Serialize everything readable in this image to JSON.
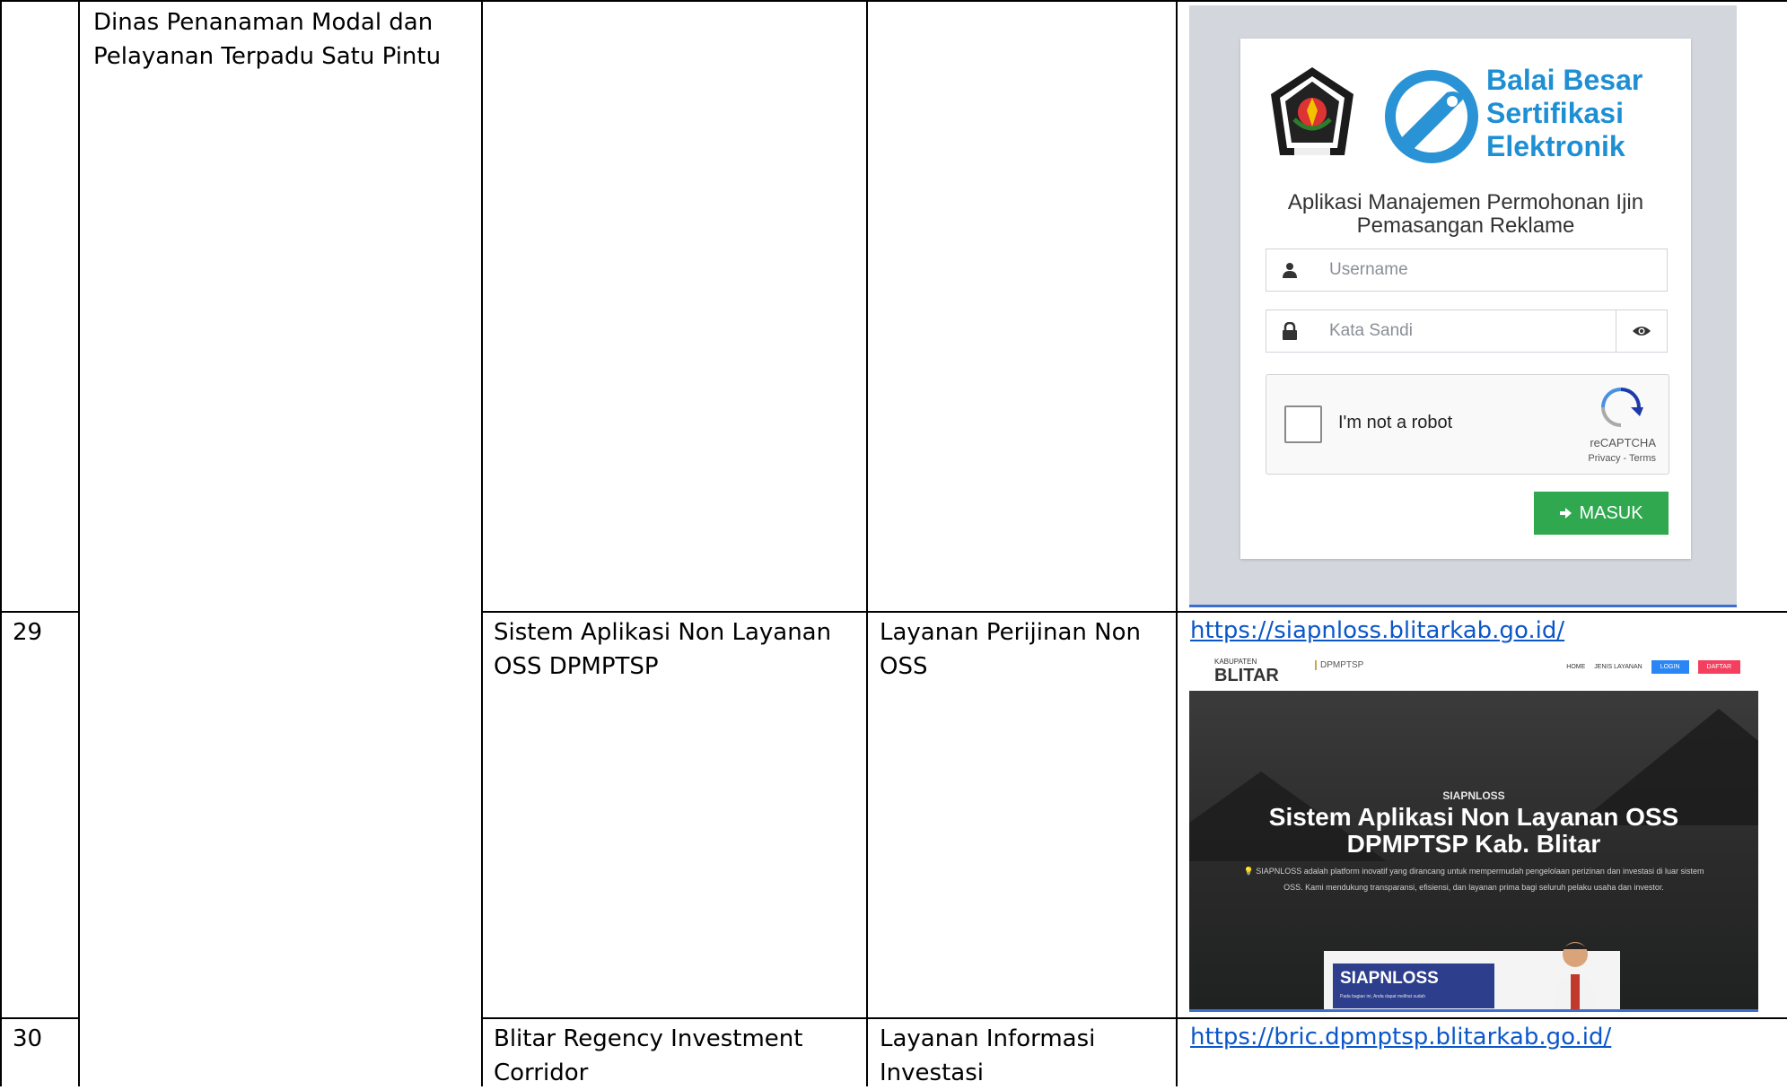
{
  "rows": [
    {
      "department": "Dinas Penanaman Modal dan\nPelayanan Terpadu Satu Pintu",
      "screenshot": {
        "logo_text": "Balai Besar\nSertifikasi\nElektronik",
        "app_title": "Aplikasi Manajemen Permohonan Ijin\nPemasangan Reklame",
        "username_placeholder": "Username",
        "password_placeholder": "Kata Sandi",
        "captcha_label": "I'm not a robot",
        "captcha_brand": "reCAPTCHA",
        "captcha_terms": "Privacy - Terms",
        "login_button": "MASUK",
        "login_button_color": "#2fa84f",
        "icons": [
          "regency-emblem-icon",
          "bbse-logo-icon",
          "user-icon",
          "lock-icon",
          "eye-icon",
          "recaptcha-icon",
          "sign-in-icon"
        ]
      }
    },
    {
      "number": "29",
      "app_name": "Sistem Aplikasi Non Layanan\nOSS DPMPTSP",
      "service": " Layanan Perijinan Non\nOSS",
      "url": "https://siapnloss.blitarkab.go.id/",
      "screenshot": {
        "brand_small": "KABUPATEN",
        "brand": "BLITAR",
        "dept_logo": "DPMPTSP",
        "nav_items": [
          "HOME",
          "JENIS LAYANAN",
          "LOGIN",
          "DAFTAR"
        ],
        "kicker": "SIAPNLOSS",
        "heading": "Sistem Aplikasi Non Layanan OSS\nDPMPTSP Kab. Blitar",
        "description": "💡 SIAPNLOSS adalah platform inovatif yang dirancang untuk mempermudah pengelolaan perizinan dan investasi di luar sistem OSS. Kami mendukung transparansi, efisiensi, dan layanan prima bagi seluruh pelaku usaha dan investor.",
        "card_title": "SIAPNLOSS",
        "card_subtitle": "Pada bagian ini, Anda dapat melihat sudah"
      }
    },
    {
      "number": "30",
      "app_name": "Blitar Regency Investment\nCorridor",
      "service": " Layanan Informasi\nInvestasi",
      "url": "https://bric.dpmptsp.blitarkab.go.id/"
    }
  ]
}
